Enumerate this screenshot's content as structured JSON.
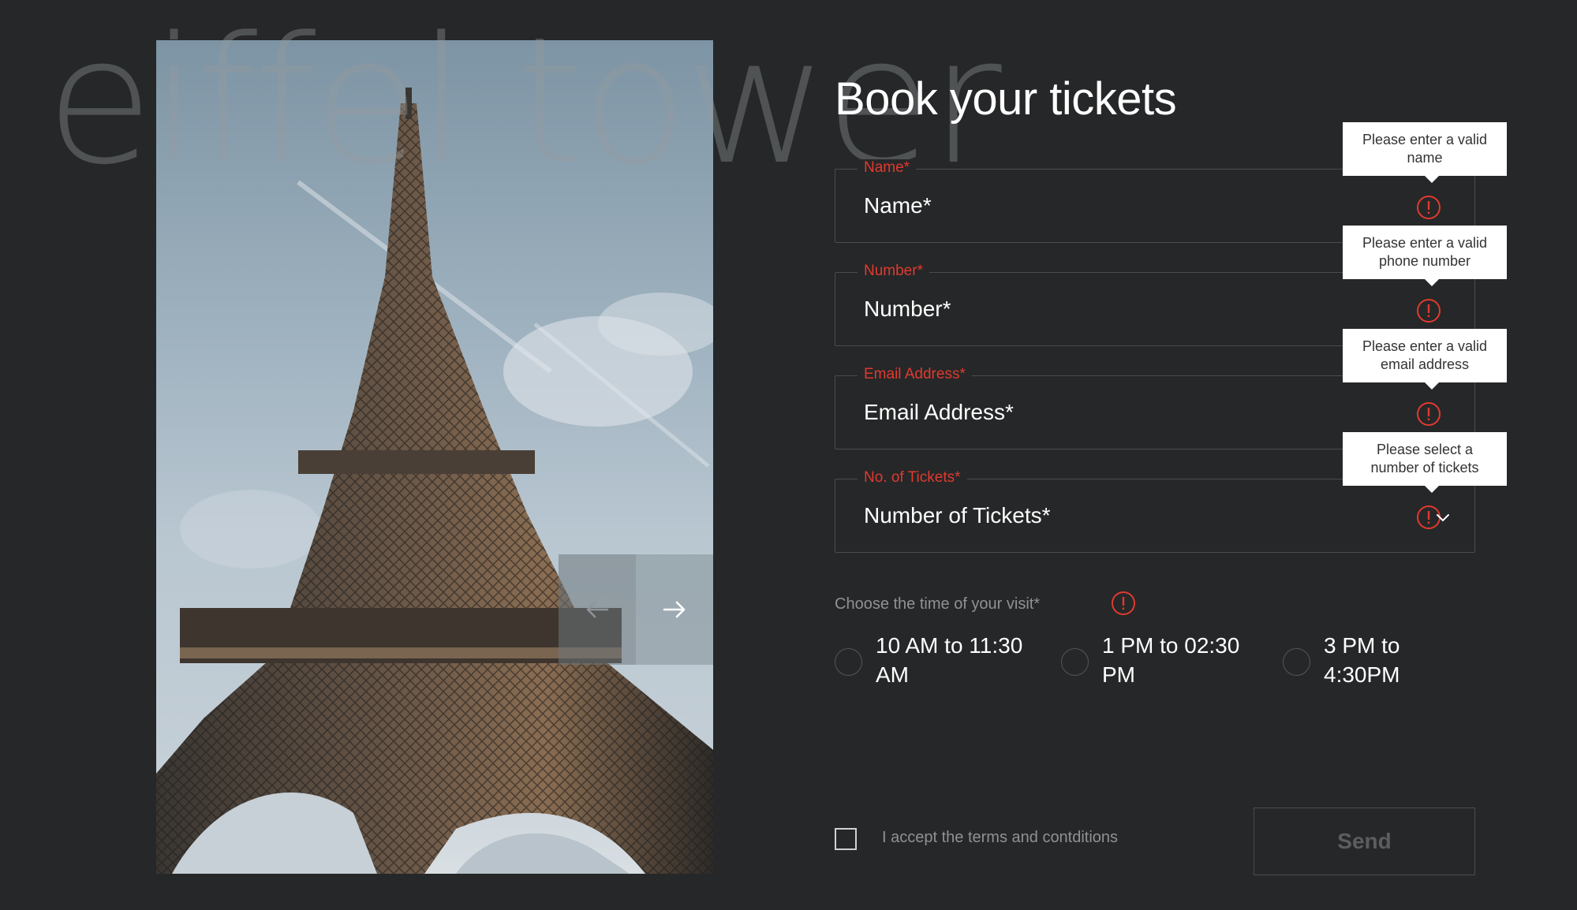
{
  "watermark": "eiffel tower",
  "form": {
    "title": "Book your tickets",
    "fields": [
      {
        "legend": "Name*",
        "value": "Name*",
        "tooltip": "Please enter a valid name"
      },
      {
        "legend": "Number*",
        "value": "Number*",
        "tooltip": "Please enter a valid phone number"
      },
      {
        "legend": "Email Address*",
        "value": "Email Address*",
        "tooltip": "Please enter a valid email address"
      },
      {
        "legend": "No. of Tickets*",
        "value": "Number of Tickets*",
        "tooltip": "Please select a number of tickets"
      }
    ],
    "visit_label": "Choose the time of your visit*",
    "time_options": [
      "10 AM to 11:30 AM",
      "1 PM to 02:30 PM",
      "3 PM to 4:30PM"
    ],
    "terms_label": "I accept the terms and contditions",
    "send_label": "Send"
  },
  "colors": {
    "background": "#262728",
    "error": "#e03a2f",
    "muted_text": "#8f9193"
  },
  "icons": {
    "error": "alert-circle-icon",
    "prev": "arrow-left-icon",
    "next": "arrow-right-icon",
    "dropdown": "chevron-down-icon"
  }
}
